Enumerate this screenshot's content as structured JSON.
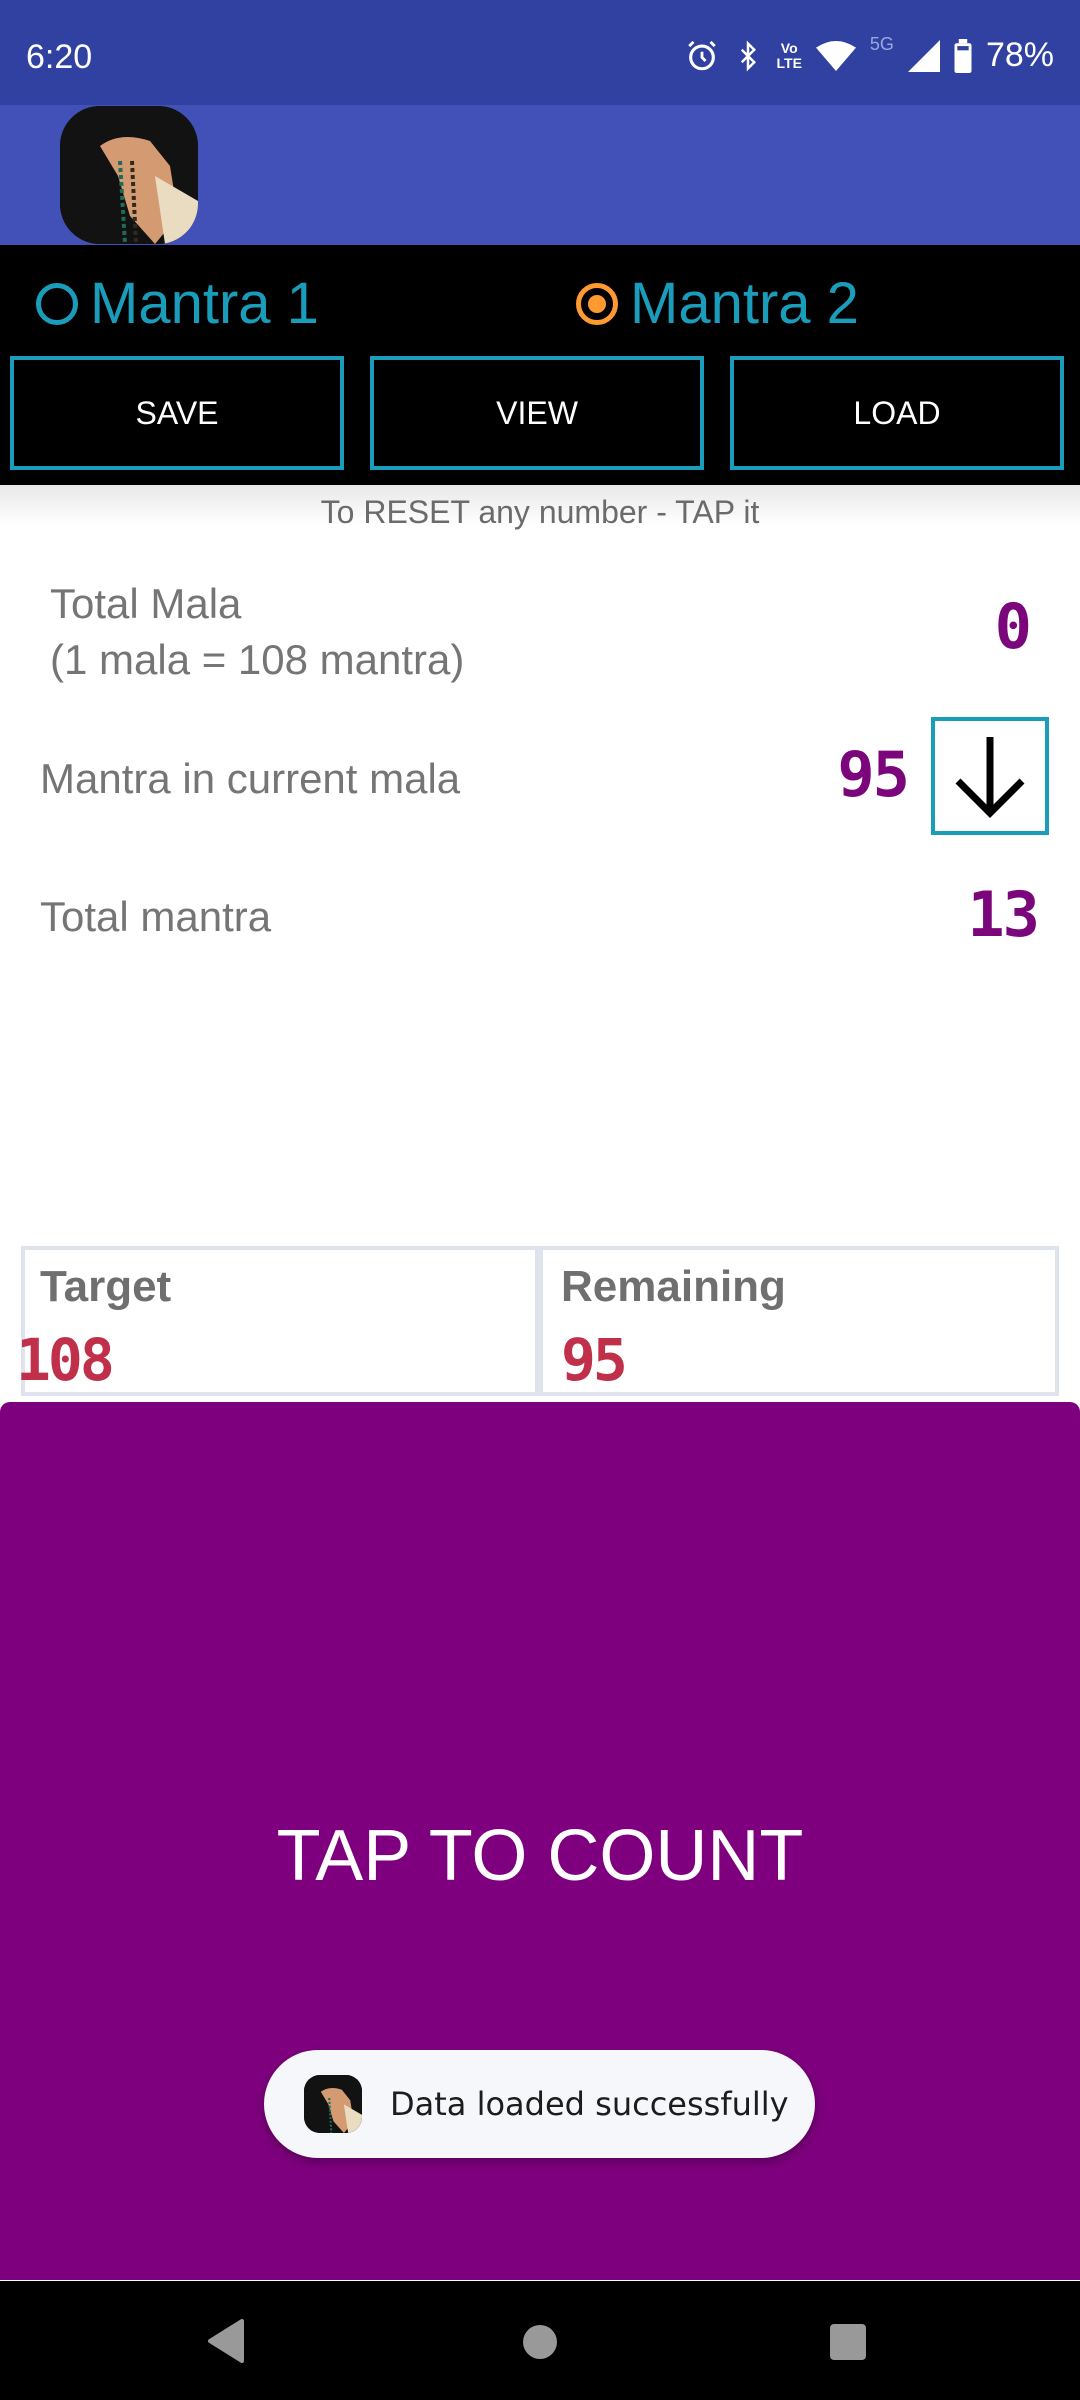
{
  "status_bar": {
    "time": "6:20",
    "icons": [
      "alarm-icon",
      "bluetooth-icon",
      "volte-icon",
      "wifi-icon",
      "5g-icon",
      "signal-icon",
      "battery-icon"
    ],
    "network_label": "5G",
    "volte_label_top": "Vo",
    "volte_label_bottom": "LTE",
    "battery": "78%"
  },
  "app_bar": {
    "logo": "mala-beads-hand-image"
  },
  "mantra_selector": {
    "options": [
      {
        "label": "Mantra 1",
        "selected": false
      },
      {
        "label": "Mantra 2",
        "selected": true
      }
    ]
  },
  "toolbar": {
    "save_label": "SAVE",
    "view_label": "VIEW",
    "load_label": "LOAD"
  },
  "hint": "To RESET any number - TAP it",
  "counters": {
    "total_mala_label": "Total Mala",
    "total_mala_sublabel": "(1 mala = 108 mantra)",
    "total_mala_value": "0",
    "current_mala_label": "Mantra in current mala",
    "current_mala_value": "95",
    "current_mala_direction": "down-arrow-icon",
    "total_mantra_label": "Total mantra",
    "total_mantra_value": "13"
  },
  "target_panel": {
    "target_label": "Target",
    "target_value": "108",
    "remaining_label": "Remaining",
    "remaining_value": "95"
  },
  "tap_area": {
    "label": "TAP TO COUNT"
  },
  "toast": {
    "message": "Data loaded successfully"
  },
  "colors": {
    "status_bar": "#3041a1",
    "app_bar": "#4151b7",
    "accent_teal": "#1a9dbb",
    "radio_selected": "#ff9a30",
    "counter_purple": "#7b067b",
    "target_red": "#c0304a",
    "tap_area": "#7e007e"
  }
}
